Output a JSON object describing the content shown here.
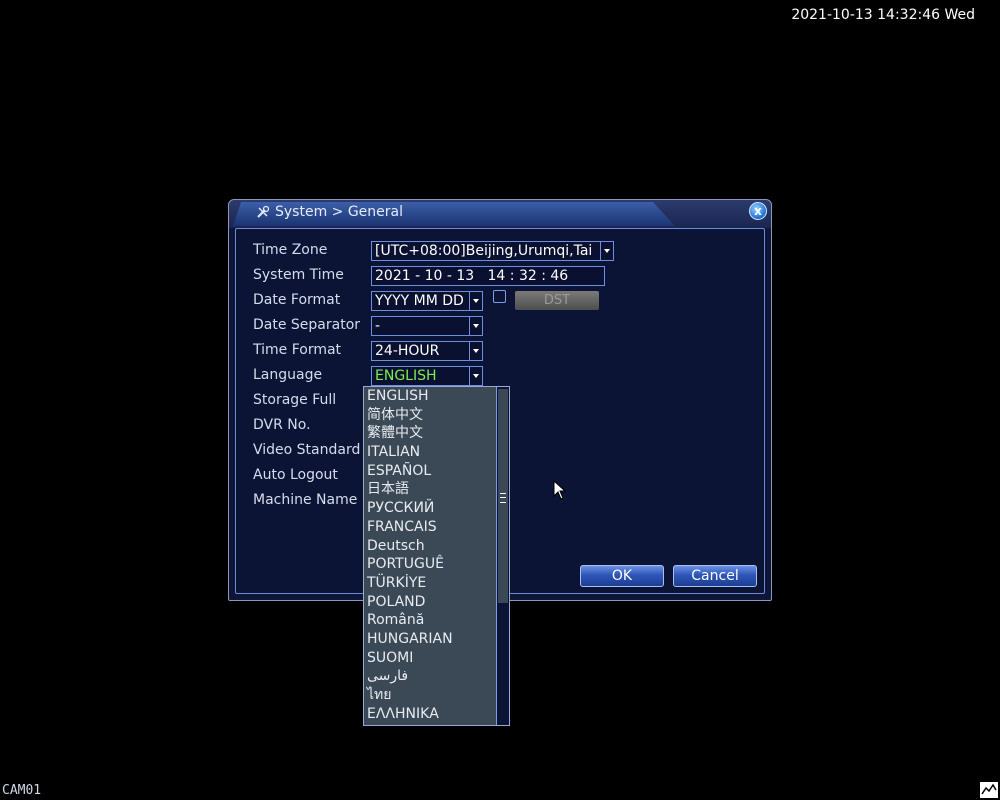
{
  "status_bar": {
    "datetime": "2021-10-13 14:32:46 Wed",
    "camera": "CAM01"
  },
  "dialog": {
    "title": "System > General",
    "close_label": "x",
    "fields": {
      "time_zone": {
        "label": "Time Zone",
        "value": "[UTC+08:00]Beijing,Urumqi,Tai"
      },
      "system_time": {
        "label": "System Time",
        "value": "2021 - 10 - 13   14 : 32 : 46"
      },
      "date_format": {
        "label": "Date Format",
        "value": "YYYY MM DD"
      },
      "date_separator": {
        "label": "Date Separator",
        "value": "-"
      },
      "time_format": {
        "label": "Time Format",
        "value": "24-HOUR"
      },
      "language": {
        "label": "Language",
        "value": "ENGLISH"
      },
      "storage_full": {
        "label": "Storage Full"
      },
      "dvr_no": {
        "label": "DVR No."
      },
      "video_standard": {
        "label": "Video Standard"
      },
      "auto_logout": {
        "label": "Auto Logout"
      },
      "machine_name": {
        "label": "Machine Name"
      }
    },
    "dst_label": "DST",
    "ok_label": "OK",
    "cancel_label": "Cancel"
  },
  "language_dropdown": {
    "options": [
      "ENGLISH",
      "简体中文",
      "繁體中文",
      "ITALIAN",
      "ESPAÑOL",
      "日本語",
      "РУССКИЙ",
      "FRANCAIS",
      "Deutsch",
      "PORTUGUÊ",
      "TÜRKİYE",
      "POLAND",
      "Română",
      "HUNGARIAN",
      "SUOMI",
      "فارسی",
      "ไทย",
      "ΕΛΛΗΝΙΚΑ"
    ]
  },
  "colors": {
    "accent": "#2f56b8",
    "selected_language": "#7cf04a"
  }
}
